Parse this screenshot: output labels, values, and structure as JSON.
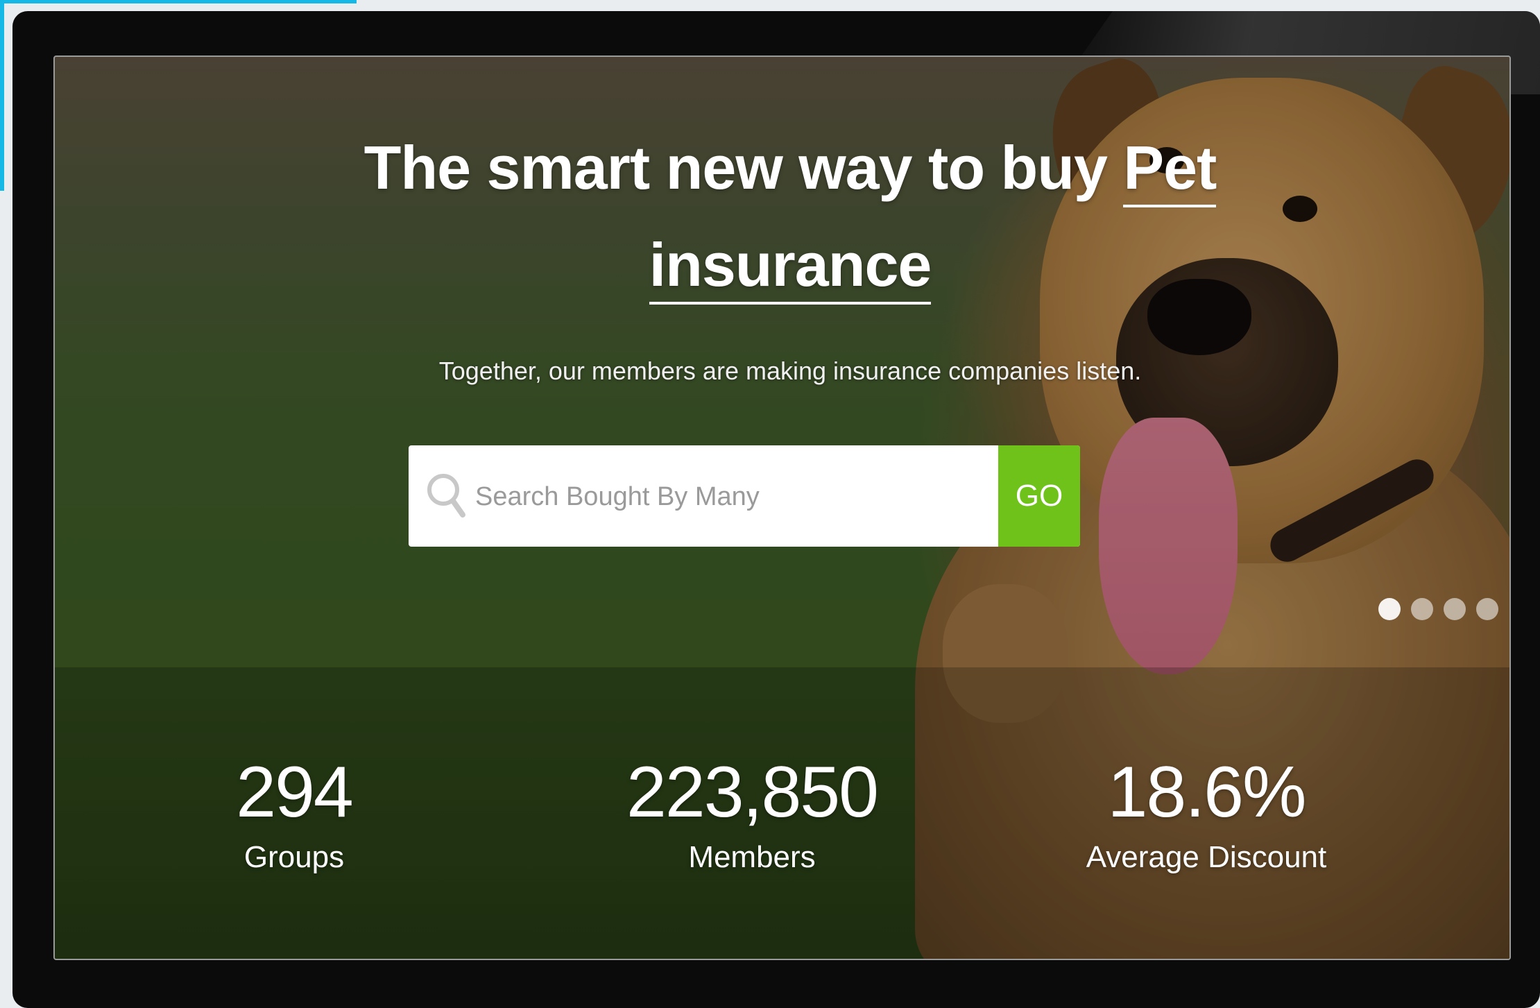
{
  "hero": {
    "title_part1": "The smart new way to buy ",
    "title_highlight1": "Pet",
    "title_highlight2": "insurance",
    "subtitle": "Together, our members are making insurance companies listen."
  },
  "search": {
    "placeholder": "Search Bought By Many",
    "button_label": "GO",
    "icon": "search-icon"
  },
  "carousel": {
    "slide_count": 4,
    "active_index": 0
  },
  "stats": [
    {
      "value": "294",
      "label": "Groups"
    },
    {
      "value": "223,850",
      "label": "Members"
    },
    {
      "value": "18.6%",
      "label": "Average Discount"
    }
  ],
  "colors": {
    "accent": "#16b8e6",
    "go_button": "#6fc21a",
    "frame": "#0b0b0b"
  }
}
